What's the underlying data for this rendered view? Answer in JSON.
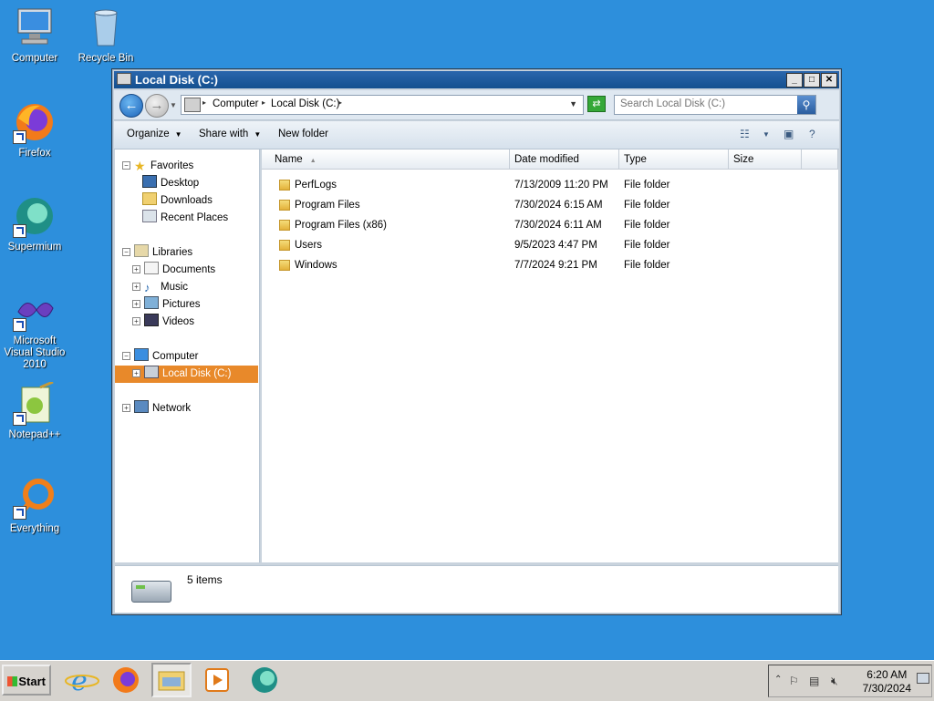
{
  "desktop": {
    "icons": [
      {
        "label": "Computer"
      },
      {
        "label": "Recycle Bin"
      },
      {
        "label": "Firefox"
      },
      {
        "label": "Supermium"
      },
      {
        "label": "Microsoft Visual Studio 2010"
      },
      {
        "label": "Notepad++"
      },
      {
        "label": "Everything"
      }
    ]
  },
  "window": {
    "title": "Local Disk (C:)",
    "address": {
      "crumbs": [
        "Computer",
        "Local Disk (C:)"
      ]
    },
    "search_placeholder": "Search Local Disk (C:)",
    "toolbar": {
      "organize": "Organize",
      "share_with": "Share with",
      "new_folder": "New folder"
    },
    "nav": {
      "favorites": "Favorites",
      "desktop": "Desktop",
      "downloads": "Downloads",
      "recent": "Recent Places",
      "libraries": "Libraries",
      "documents": "Documents",
      "music": "Music",
      "pictures": "Pictures",
      "videos": "Videos",
      "computer": "Computer",
      "local_disk": "Local Disk (C:)",
      "network": "Network"
    },
    "columns": {
      "name": "Name",
      "date": "Date modified",
      "type": "Type",
      "size": "Size"
    },
    "files": [
      {
        "name": "PerfLogs",
        "date": "7/13/2009 11:20 PM",
        "type": "File folder",
        "size": ""
      },
      {
        "name": "Program Files",
        "date": "7/30/2024 6:15 AM",
        "type": "File folder",
        "size": ""
      },
      {
        "name": "Program Files (x86)",
        "date": "7/30/2024 6:11 AM",
        "type": "File folder",
        "size": ""
      },
      {
        "name": "Users",
        "date": "9/5/2023 4:47 PM",
        "type": "File folder",
        "size": ""
      },
      {
        "name": "Windows",
        "date": "7/7/2024 9:21 PM",
        "type": "File folder",
        "size": ""
      }
    ],
    "status": "5 items"
  },
  "taskbar": {
    "start": "Start",
    "time": "6:20 AM",
    "date": "7/30/2024"
  }
}
